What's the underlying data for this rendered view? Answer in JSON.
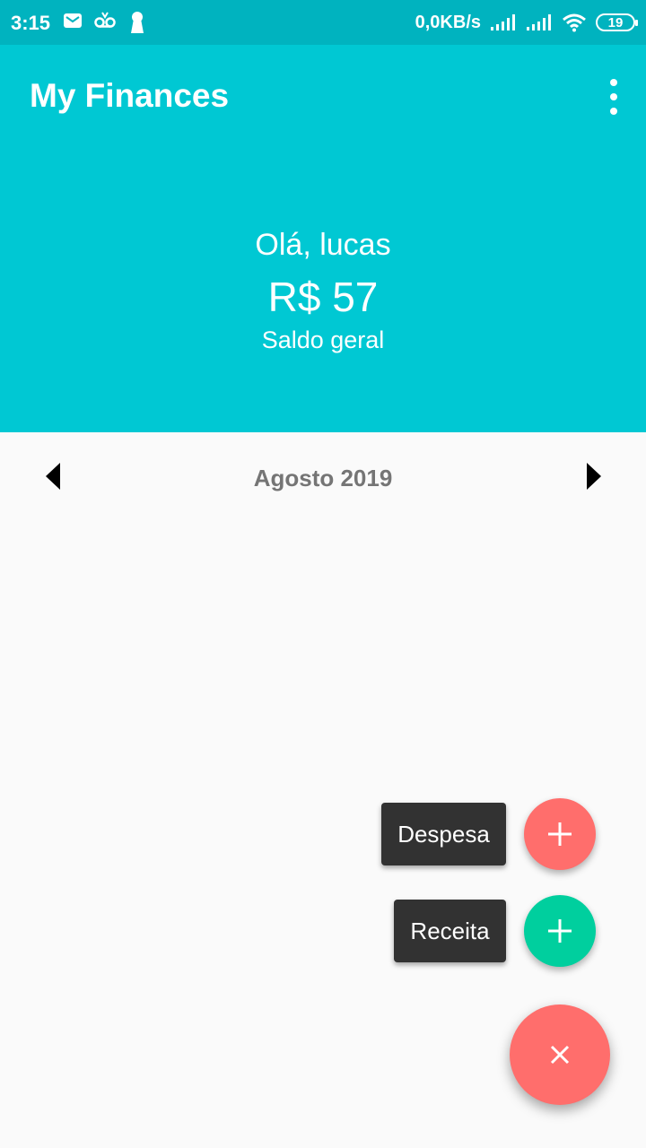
{
  "status_bar": {
    "time": "3:15",
    "net_speed": "0,0KB/s",
    "battery": "19"
  },
  "app": {
    "title": "My Finances"
  },
  "summary": {
    "greeting": "Olá, lucas",
    "balance": "R$ 57",
    "balance_label": "Saldo geral"
  },
  "month_nav": {
    "month": "Agosto 2019"
  },
  "fab_menu": {
    "expense_label": "Despesa",
    "income_label": "Receita"
  },
  "colors": {
    "status_bar": "#00b3bf",
    "header": "#00c8d3",
    "expense": "#ff6e6c",
    "income": "#00cf9e",
    "label_bg": "#323232"
  }
}
